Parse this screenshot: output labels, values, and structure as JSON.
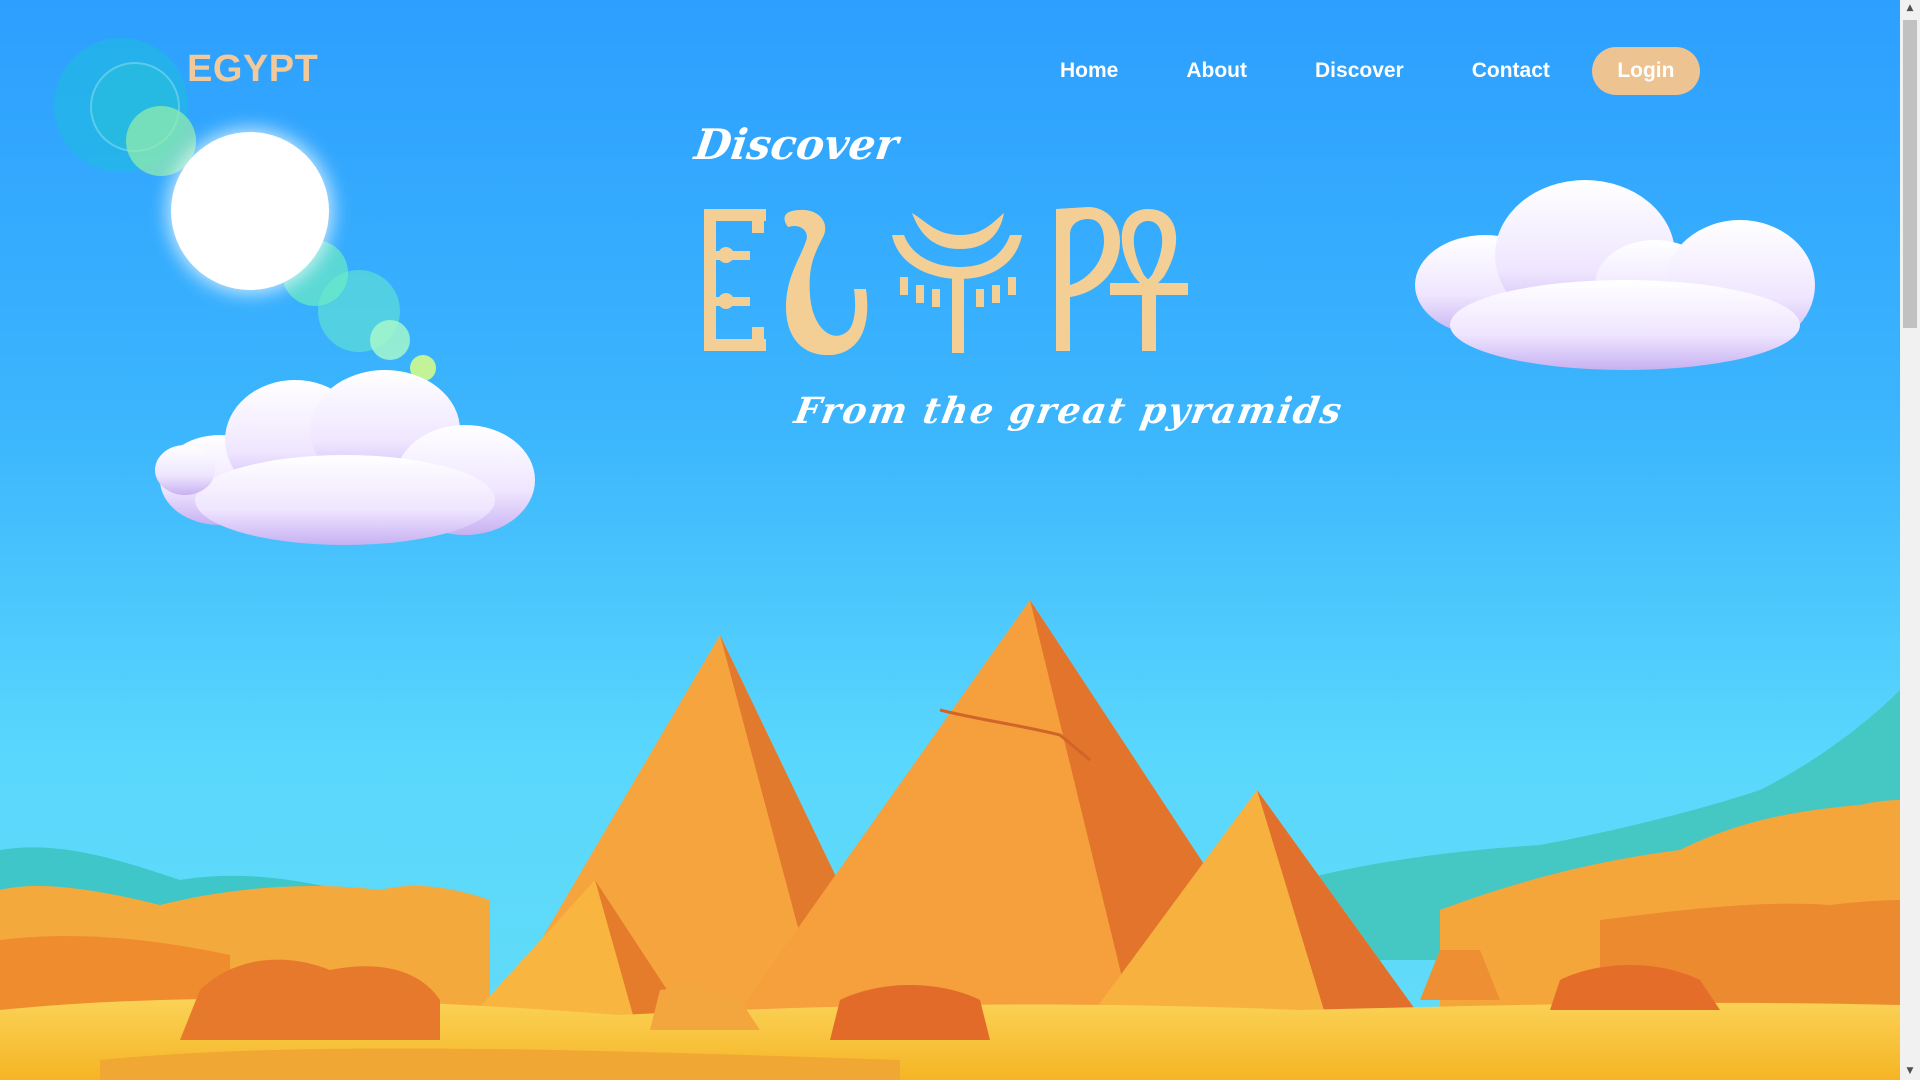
{
  "header": {
    "logo": "EGYPT",
    "nav": [
      {
        "label": "Home"
      },
      {
        "label": "About"
      },
      {
        "label": "Discover"
      },
      {
        "label": "Contact"
      }
    ],
    "login_label": "Login"
  },
  "hero": {
    "pre_title": "Discover",
    "title": "EGYPT",
    "subtitle": "From the great pyramids"
  },
  "colors": {
    "accent": "#ecc391",
    "logo": "#f1c99a",
    "sky_top": "#2d9fff",
    "sky_bottom": "#62dcf6",
    "sand": "#f7c23a",
    "pyramid": "#f49436"
  },
  "icons": {
    "scroll_up": "triangle-up",
    "scroll_down": "triangle-down"
  }
}
